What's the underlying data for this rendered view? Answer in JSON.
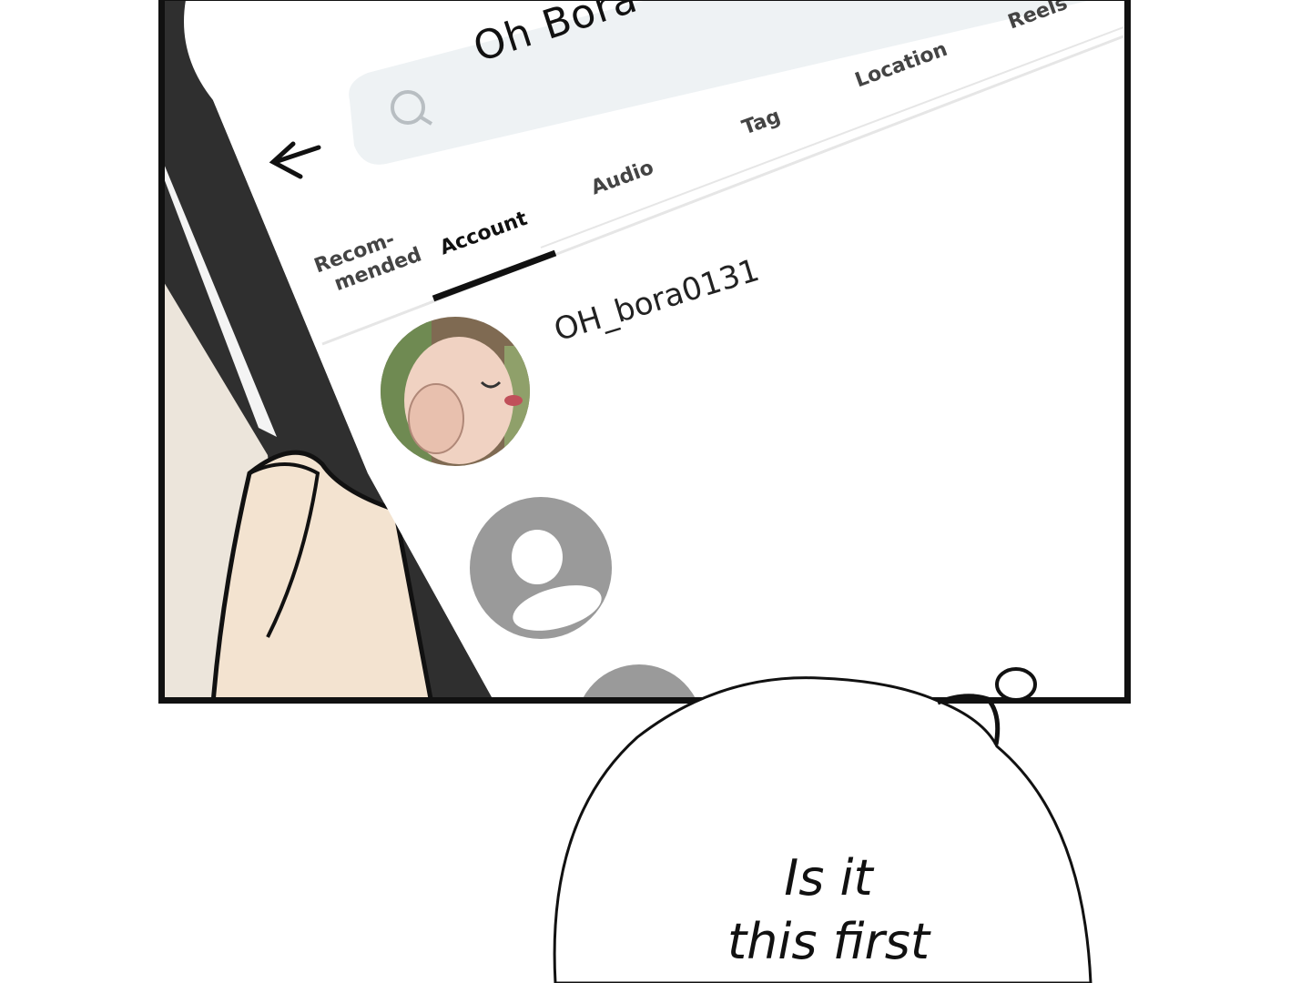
{
  "search": {
    "query": "Oh Bora"
  },
  "tabs": [
    {
      "label": "Recom-\nmended",
      "line1": "Recom-",
      "line2": "mended"
    },
    {
      "label": "Account"
    },
    {
      "label": "Audio"
    },
    {
      "label": "Tag"
    },
    {
      "label": "Location"
    },
    {
      "label": "Reels"
    }
  ],
  "results": [
    {
      "username": "OH_bora0131"
    }
  ],
  "speech_bubble": {
    "line1": "Is it",
    "line2": "this first"
  },
  "colors": {
    "frame": "#111111",
    "phone_bezel": "#2e2e2e",
    "skin": "#f3e3d0",
    "search_bar": "#eef2f4",
    "placeholder_avatar": "#9a9a9a"
  }
}
